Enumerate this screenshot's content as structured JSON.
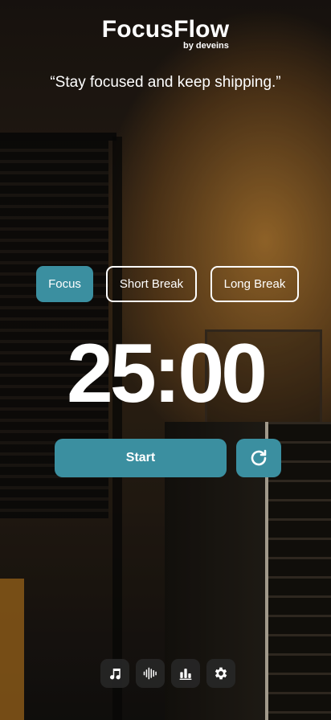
{
  "brand": {
    "title": "FocusFlow",
    "byline": "by deveins"
  },
  "quote": "“Stay focused and keep shipping.”",
  "modes": [
    {
      "label": "Focus",
      "active": true
    },
    {
      "label": "Short Break",
      "active": false
    },
    {
      "label": "Long Break",
      "active": false
    }
  ],
  "timer": "25:00",
  "controls": {
    "start_label": "Start",
    "reset_icon": "refresh-icon"
  },
  "dock": [
    {
      "icon": "music-note-icon"
    },
    {
      "icon": "audio-waveform-icon"
    },
    {
      "icon": "bar-chart-icon"
    },
    {
      "icon": "gear-icon"
    }
  ],
  "colors": {
    "accent": "#3b8fa0",
    "text": "#ffffff",
    "dock_bg": "#282828"
  }
}
